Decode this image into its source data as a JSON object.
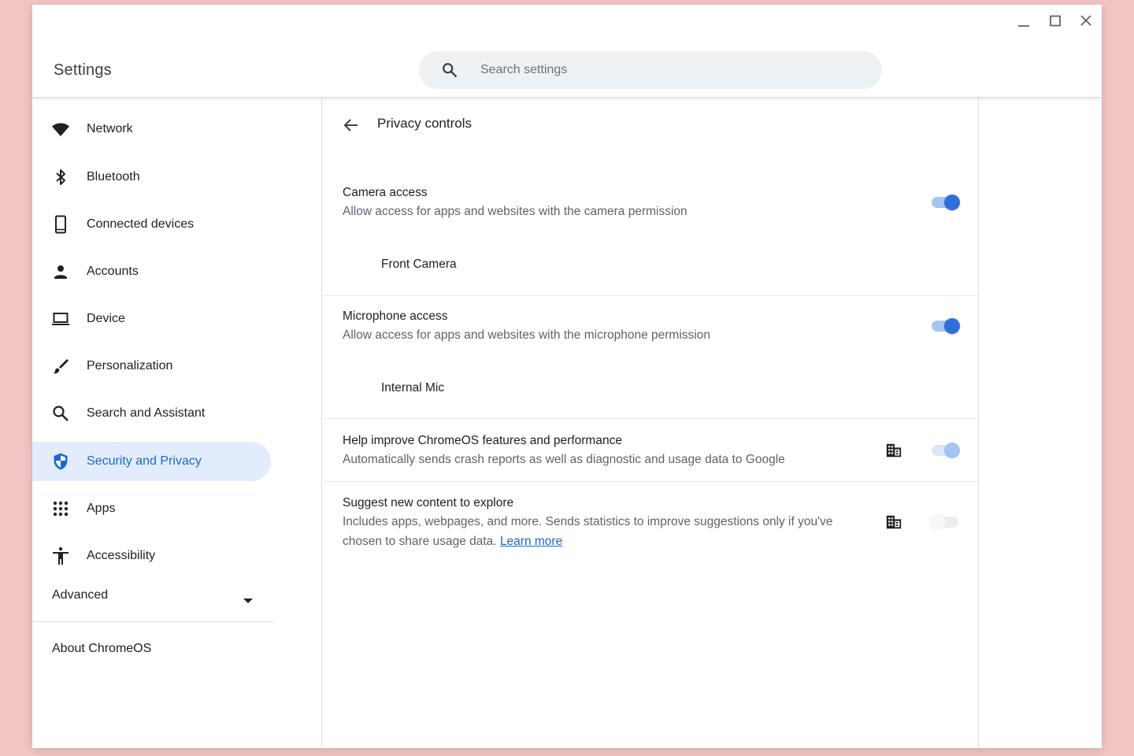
{
  "header": {
    "title": "Settings",
    "search_placeholder": "Search settings"
  },
  "sidebar": {
    "items": [
      {
        "label": "Network",
        "icon": "wifi-icon"
      },
      {
        "label": "Bluetooth",
        "icon": "bluetooth-icon"
      },
      {
        "label": "Connected devices",
        "icon": "phone-icon"
      },
      {
        "label": "Accounts",
        "icon": "person-icon"
      },
      {
        "label": "Device",
        "icon": "laptop-icon"
      },
      {
        "label": "Personalization",
        "icon": "brush-icon"
      },
      {
        "label": "Search and Assistant",
        "icon": "search-icon"
      },
      {
        "label": "Security and Privacy",
        "icon": "shield-icon",
        "active": true
      },
      {
        "label": "Apps",
        "icon": "apps-grid-icon"
      },
      {
        "label": "Accessibility",
        "icon": "accessibility-icon"
      }
    ],
    "advanced_label": "Advanced",
    "about_label": "About ChromeOS"
  },
  "main": {
    "page_title": "Privacy controls",
    "camera": {
      "title": "Camera access",
      "desc": "Allow access for apps and websites with the camera permission",
      "subitem": "Front Camera",
      "enabled": true
    },
    "microphone": {
      "title": "Microphone access",
      "desc": "Allow access for apps and websites with the microphone permission",
      "subitem": "Internal Mic",
      "enabled": true
    },
    "help_improve": {
      "title": "Help improve ChromeOS features and performance",
      "desc": "Automatically sends crash reports as well as diagnostic and usage data to Google",
      "enabled": true,
      "managed": true
    },
    "suggest": {
      "title": "Suggest new content to explore",
      "desc_line1": "Includes apps, webpages, and more. Sends statistics to improve suggestions only if you've",
      "desc_line2": "chosen to share usage data.",
      "link": "Learn more",
      "enabled": false,
      "managed": true
    }
  },
  "colors": {
    "accent": "#1a66d2",
    "active_bg": "#e3ecfc",
    "toggle_on": "#2f6fdc",
    "page_bg": "#f2c4c4"
  }
}
